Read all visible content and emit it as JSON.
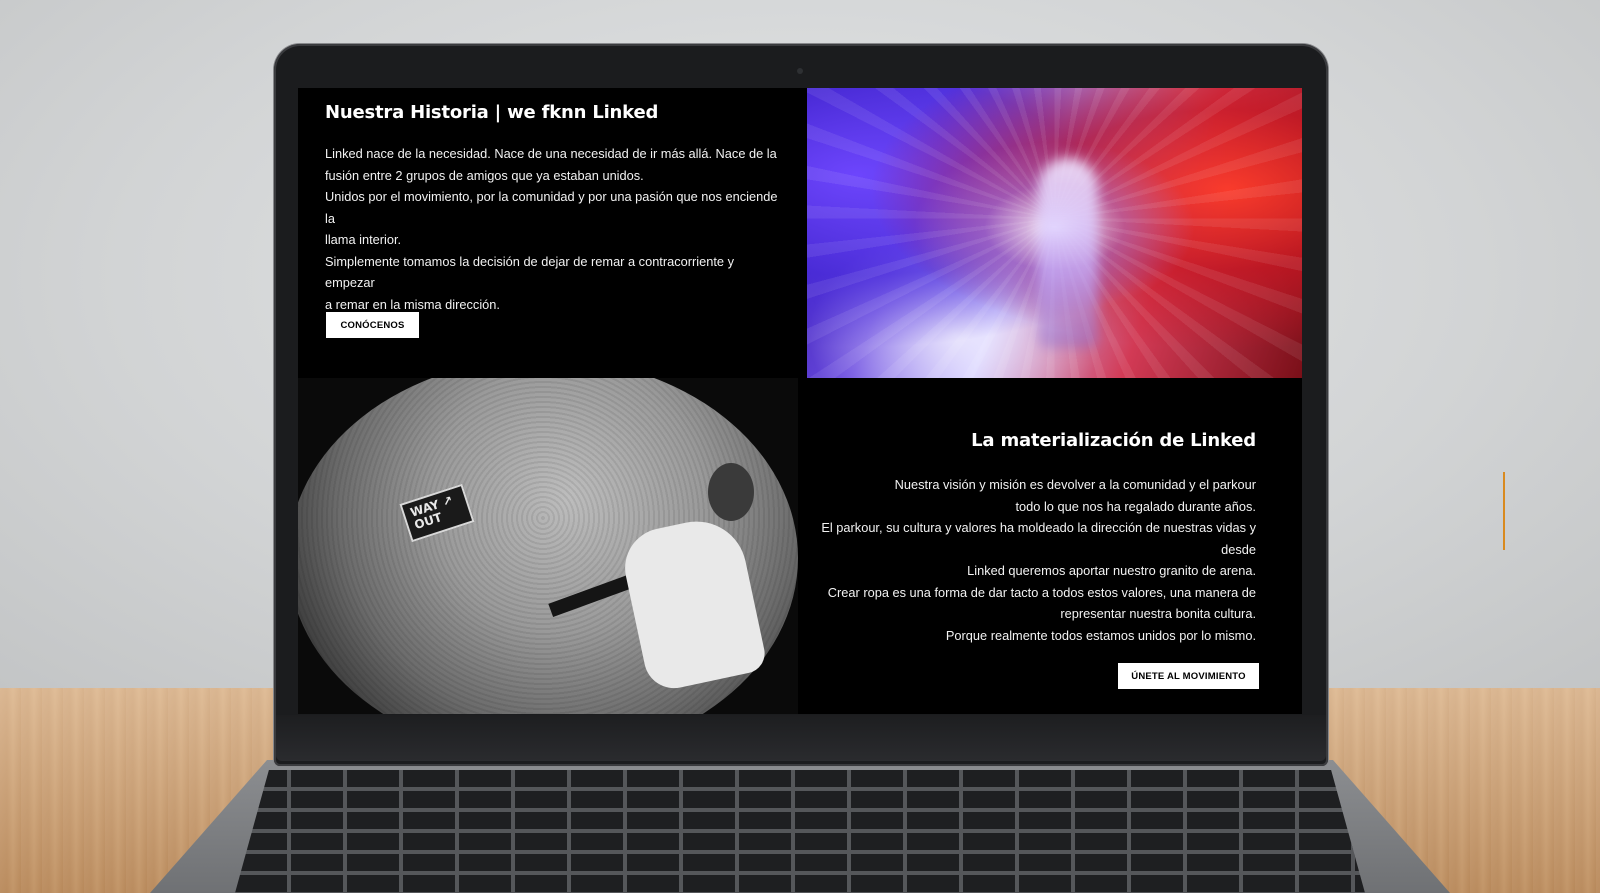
{
  "section_history": {
    "title": "Nuestra Historia | we fknn Linked",
    "lines": [
      "Linked nace de la necesidad. Nace de una necesidad de ir más allá. Nace de la",
      "fusión entre 2 grupos de amigos que ya estaban unidos.",
      "Unidos por el movimiento, por la comunidad y por una pasión que nos enciende la",
      "llama interior.",
      "Simplemente tomamos la decisión de dejar de remar a contracorriente y empezar",
      "a remar en la misma dirección."
    ],
    "button_label": "CONÓCENOS"
  },
  "section_materialization": {
    "title": "La materialización de Linked",
    "lines": [
      "Nuestra visión y misión es devolver a la comunidad y el parkour",
      "todo lo que nos ha regalado durante años.",
      "El parkour, su cultura y valores ha moldeado la dirección de nuestras vidas y desde",
      "Linked queremos aportar nuestro granito de arena.",
      "Crear ropa es una forma de dar tacto a todos estos valores, una manera de",
      "representar nuestra bonita cultura.",
      "Porque realmente todos estamos unidos por lo mismo."
    ],
    "button_label": "ÚNETE AL MOVIMIENTO"
  },
  "photo_sign": {
    "line1": "WAY ↗",
    "line2": "OUT"
  },
  "colors": {
    "screen_bg": "#000000",
    "text": "#ffffff",
    "button_bg": "#ffffff",
    "button_text": "#000000",
    "accent_line": "#d98a1f"
  }
}
